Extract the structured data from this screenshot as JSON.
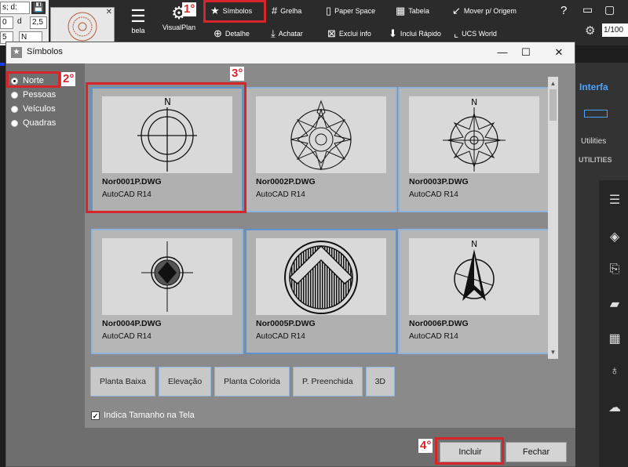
{
  "toolbar": {
    "fields": [
      "s; d:",
      "0",
      "d",
      "2,5",
      "5",
      "N"
    ],
    "items": {
      "symbols": "Símbolos",
      "grid": "Grelha",
      "paper_space": "Paper Space",
      "table": "Tabela",
      "move_origin": "Mover p/ Origem",
      "detail": "Detalhe",
      "flatten": "Achatar",
      "delete_info": "Exclui info",
      "quick_include": "Inclui Rápido",
      "ucs_world": "UCS World",
      "visualplan": "VisualPlan",
      "tabela_partial": "bela"
    },
    "scale": "1/100"
  },
  "background": {
    "interface_tab": "Interfa",
    "utilities": "Utilities",
    "utilities_caps": "UTILITIES",
    "right_icons": [
      "sliders-icon",
      "layers-icon",
      "paperclip-icon",
      "paint-icon",
      "grid-icon",
      "balloon-icon",
      "cloud-upload-icon"
    ]
  },
  "dialog": {
    "title": "Símbolos",
    "categories": [
      {
        "label": "Norte",
        "selected": true
      },
      {
        "label": "Pessoas",
        "selected": false
      },
      {
        "label": "Veículos",
        "selected": false
      },
      {
        "label": "Quadras",
        "selected": false
      }
    ],
    "cards": [
      {
        "name": "Nor0001P.DWG",
        "format": "AutoCAD R14",
        "selected": true
      },
      {
        "name": "Nor0002P.DWG",
        "format": "AutoCAD R14",
        "selected": false
      },
      {
        "name": "Nor0003P.DWG",
        "format": "AutoCAD R14",
        "selected": false
      },
      {
        "name": "Nor0004P.DWG",
        "format": "AutoCAD R14",
        "selected": false
      },
      {
        "name": "Nor0005P.DWG",
        "format": "AutoCAD R14",
        "selected": false
      },
      {
        "name": "Nor0006P.DWG",
        "format": "AutoCAD R14",
        "selected": false
      }
    ],
    "view_modes": [
      "Planta Baixa",
      "Elevação",
      "Planta Colorida",
      "P. Preenchida",
      "3D"
    ],
    "show_size_checkbox": {
      "label": "Indica Tamanho na Tela",
      "checked": true
    },
    "buttons": {
      "include": "Incluir",
      "close": "Fechar"
    }
  },
  "annotations": [
    "1°",
    "2°",
    "3°",
    "4°"
  ],
  "colors": {
    "annotation": "#d7262b",
    "card_border": "#8fb4dc",
    "accent": "#4aa3ff"
  }
}
